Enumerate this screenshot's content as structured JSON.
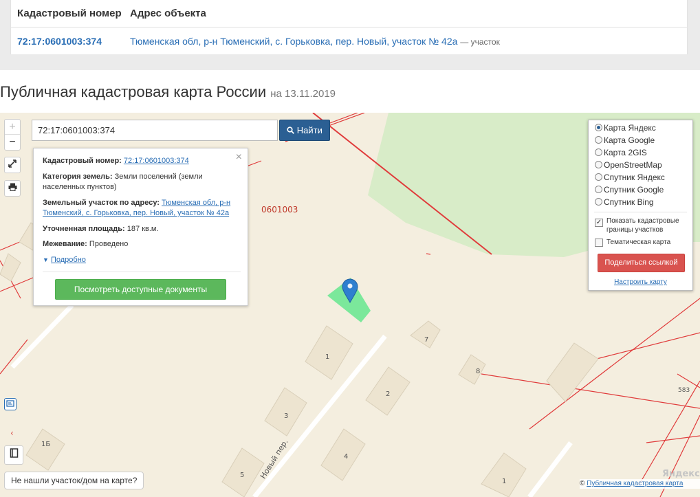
{
  "results": {
    "headers": [
      "Кадастровый номер",
      "Адрес объекта"
    ],
    "rows": [
      {
        "cadastral_number": "72:17:0601003:374",
        "address": "Тюменская обл, р-н Тюменский, с. Горьковка, пер. Новый, участок № 42а",
        "type": "— участок"
      }
    ]
  },
  "page": {
    "title": "Публичная кадастровая карта России",
    "date": "на 13.11.2019"
  },
  "map": {
    "zoom_in": "+",
    "zoom_out": "−",
    "search": {
      "value": "72:17:0601003:374",
      "button_label": "Найти"
    },
    "popup": {
      "rows": [
        {
          "label": "Кадастровый номер:",
          "value": "72:17:0601003:374"
        },
        {
          "label": "Категория земель:",
          "value": "Земли поселений (земли населенных пунктов)"
        },
        {
          "label": "Земельный участок по адресу:",
          "value": "Тюменская обл, р-н Тюменский, с. Горьковка, пер. Новый, участок № 42а"
        },
        {
          "label": "Уточненная площадь:",
          "value": "187 кв.м."
        },
        {
          "label": "Межевание:",
          "value": "Проведено"
        }
      ],
      "more_link": "Подробно",
      "docs_button": "Посмотреть доступные документы",
      "close": "×"
    },
    "layers": [
      {
        "label": "Карта Яндекс",
        "selected": true
      },
      {
        "label": "Карта Google",
        "selected": false
      },
      {
        "label": "Карта 2GIS",
        "selected": false
      },
      {
        "label": "OpenStreetMap",
        "selected": false
      },
      {
        "label": "Спутник Яндекс",
        "selected": false
      },
      {
        "label": "Спутник Google",
        "selected": false
      },
      {
        "label": "Спутник Bing",
        "selected": false
      }
    ],
    "options": [
      {
        "label": "Показать кадастровые границы участков",
        "checked": true
      },
      {
        "label": "Тематическая карта",
        "checked": false
      }
    ],
    "share_button": "Поделиться ссылкой",
    "configure_link": "Настроить карту",
    "not_found": "Не нашли участок/дом на карте?",
    "attribution": {
      "prefix": "© ",
      "link": "Публичная кадастровая карта"
    },
    "logo": "Яндекс",
    "labels": {
      "quarter": "0601003",
      "street": "Новый пер.",
      "house_1": "1",
      "house_2": "2",
      "house_3": "3",
      "house_4": "4",
      "house_5": "5",
      "house_7": "7",
      "house_8": "8",
      "house_1b": "1Б",
      "house_1c": "1",
      "plot_583": "583"
    },
    "colors": {
      "background": "#f4eedf",
      "green_area": "#d8ecc8",
      "boundary": "#e03b3b",
      "building": "#ede4d0",
      "plot": "#7be89b",
      "marker": "#2e7fcf"
    }
  }
}
